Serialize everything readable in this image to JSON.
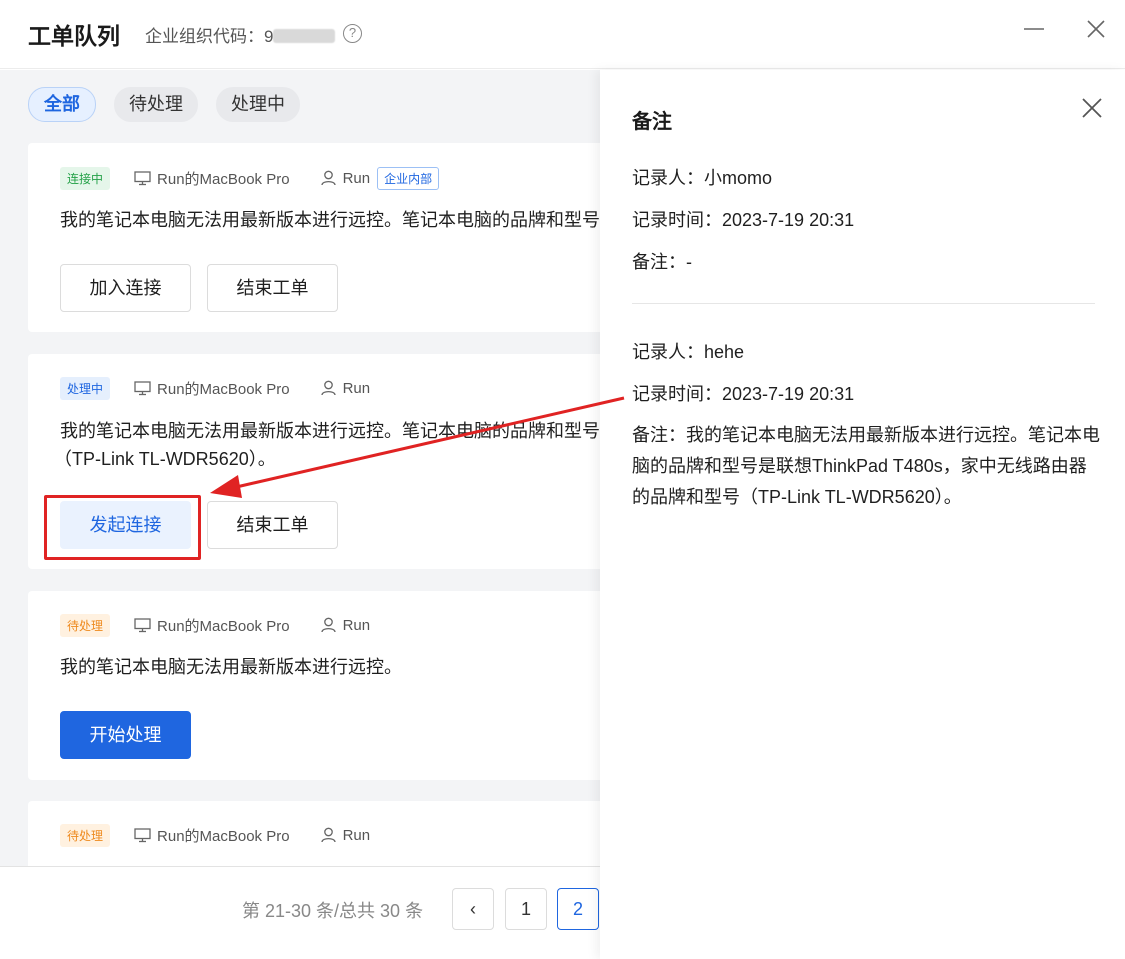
{
  "header": {
    "title": "工单队列",
    "org_label": "企业组织代码：",
    "org_code_prefix": "9",
    "help": "?"
  },
  "tabs": [
    {
      "label": "全部",
      "active": true
    },
    {
      "label": "待处理",
      "active": false
    },
    {
      "label": "处理中",
      "active": false
    }
  ],
  "cards": [
    {
      "status": "连接中",
      "device": "Run的MacBook Pro",
      "user": "Run",
      "tag": "企业内部",
      "description": "我的笔记本电脑无法用最新版本进行远控。笔记本电脑的品牌和型号",
      "buttons": [
        "加入连接",
        "结束工单"
      ]
    },
    {
      "status": "处理中",
      "device": "Run的MacBook Pro",
      "user": "Run",
      "description": "我的笔记本电脑无法用最新版本进行远控。笔记本电脑的品牌和型号",
      "description_line2": "（TP-Link TL-WDR5620）。",
      "buttons": [
        "发起连接",
        "结束工单"
      ]
    },
    {
      "status": "待处理",
      "device": "Run的MacBook Pro",
      "user": "Run",
      "description": "我的笔记本电脑无法用最新版本进行远控。",
      "buttons": [
        "开始处理"
      ]
    },
    {
      "status": "待处理",
      "device": "Run的MacBook Pro",
      "user": "Run"
    }
  ],
  "pagination": {
    "info": "第 21-30 条/总共 30 条",
    "prev": "‹",
    "pages": [
      "1",
      "2"
    ],
    "current": "2"
  },
  "panel": {
    "title": "备注",
    "records": [
      {
        "recorder": "记录人：小momo",
        "time": "记录时间：2023-7-19 20:31",
        "note": "备注：-"
      },
      {
        "recorder": "记录人：hehe",
        "time": "记录时间：2023-7-19 20:31",
        "note": "备注：我的笔记本电脑无法用最新版本进行远控。笔记本电脑的品牌和型号是联想ThinkPad T480s，家中无线路由器的品牌和型号（TP-Link TL-WDR5620）。"
      }
    ]
  },
  "colors": {
    "primary": "#1f66e0",
    "annotation_red": "#e02323",
    "status_green": "#24a148",
    "status_orange": "#ee8a1f"
  }
}
